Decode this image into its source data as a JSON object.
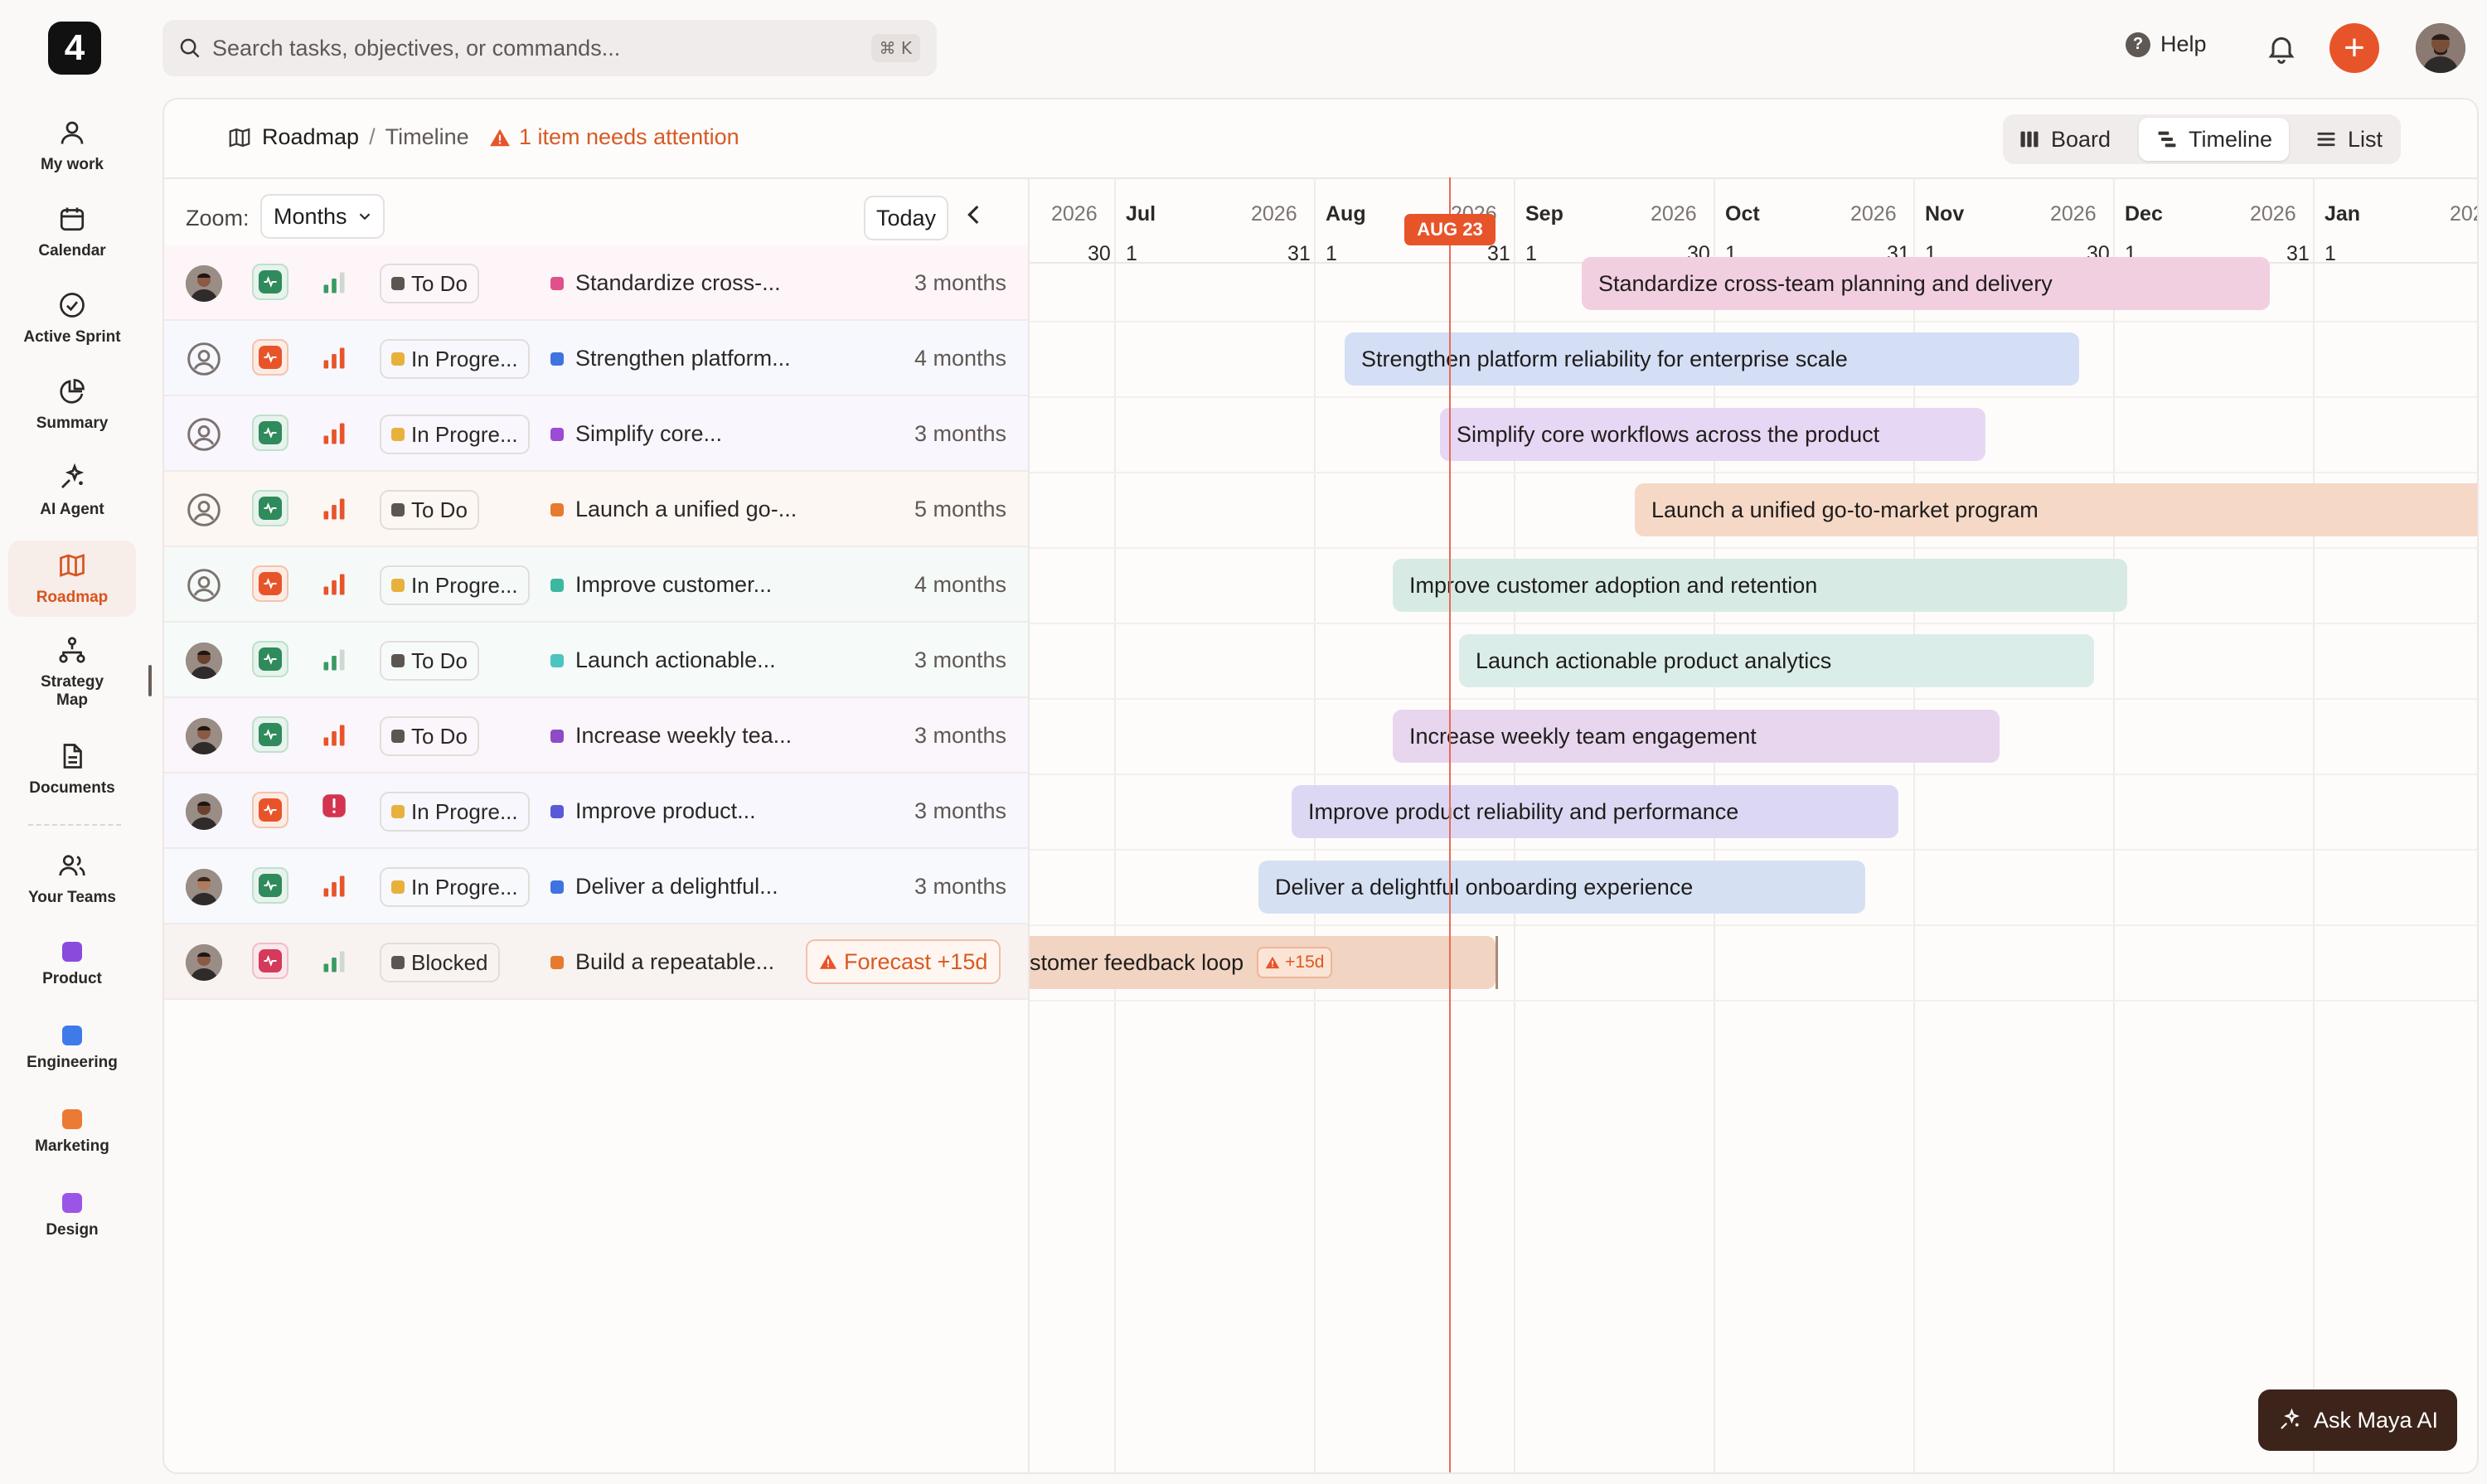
{
  "app": {
    "logo_text": "4"
  },
  "sidebar": {
    "items": [
      {
        "label": "My work"
      },
      {
        "label": "Calendar"
      },
      {
        "label": "Active Sprint"
      },
      {
        "label": "Summary"
      },
      {
        "label": "AI Agent"
      },
      {
        "label": "Roadmap",
        "active": true
      },
      {
        "label": "Strategy Map"
      },
      {
        "label": "Documents"
      }
    ],
    "teams_label": "Your Teams",
    "teams": [
      {
        "label": "Product",
        "color": "#8a4bdc"
      },
      {
        "label": "Engineering",
        "color": "#3f7be8"
      },
      {
        "label": "Marketing",
        "color": "#ec7a34"
      },
      {
        "label": "Design",
        "color": "#9b55e6"
      }
    ]
  },
  "topbar": {
    "search_placeholder": "Search tasks, objectives, or commands...",
    "shortcut": "⌘ K",
    "help_label": "Help",
    "help_icon": "?",
    "plus_symbol": "+"
  },
  "breadcrumb": {
    "root": "Roadmap",
    "separator": "/",
    "current": "Timeline"
  },
  "attention": {
    "text": "1 item needs attention"
  },
  "views": {
    "board": "Board",
    "timeline": "Timeline",
    "list": "List",
    "active": "timeline"
  },
  "toolbar": {
    "zoom_label": "Zoom:",
    "zoom_value": "Months",
    "today": "Today"
  },
  "timeline": {
    "today_label": "AUG 23",
    "header": {
      "years": [
        "2026",
        "2026",
        "2026",
        "2026",
        "2026",
        "2026",
        "2026",
        "202"
      ],
      "months": [
        "Jul",
        "Aug",
        "Sep",
        "Oct",
        "Nov",
        "Dec",
        "Jan"
      ],
      "end_days": [
        "30",
        "31",
        "31",
        "30",
        "31",
        "30",
        "31",
        "3"
      ],
      "start_day": "1"
    }
  },
  "rows": [
    {
      "avatar": "man",
      "health": "green",
      "priority": "medium",
      "status": "To Do",
      "status_color": "#5c5653",
      "dot": "#e0508a",
      "title_short": "Standardize cross-...",
      "duration": "3 months",
      "bar_title": "Standardize cross-team planning and delivery",
      "bar_color": "#f2cfe0",
      "row_bg": "#fdf5f8"
    },
    {
      "avatar": "none",
      "health": "orange",
      "priority": "high",
      "status": "In Progre...",
      "status_color": "#e8b13c",
      "dot": "#3f74e0",
      "title_short": "Strengthen platform...",
      "duration": "4 months",
      "bar_title": "Strengthen platform reliability for enterprise scale",
      "bar_color": "#d4def5",
      "row_bg": "#f7f8fd"
    },
    {
      "avatar": "none",
      "health": "green",
      "priority": "high",
      "status": "In Progre...",
      "status_color": "#e8b13c",
      "dot": "#9b4bd6",
      "title_short": "Simplify core...",
      "duration": "3 months",
      "bar_title": "Simplify core workflows across the product",
      "bar_color": "#e6d8f4",
      "row_bg": "#faf6fd"
    },
    {
      "avatar": "none",
      "health": "green",
      "priority": "high",
      "status": "To Do",
      "status_color": "#5c5653",
      "dot": "#e67a2e",
      "title_short": "Launch a unified go-...",
      "duration": "5 months",
      "bar_title": "Launch a unified go-to-market program",
      "bar_color": "#f5d8c6",
      "row_bg": "#fdf7f3"
    },
    {
      "avatar": "none",
      "health": "orange",
      "priority": "high",
      "status": "In Progre...",
      "status_color": "#e8b13c",
      "dot": "#3cb8a0",
      "title_short": "Improve customer...",
      "duration": "4 months",
      "bar_title": "Improve customer adoption and retention",
      "bar_color": "#d7ebe4",
      "row_bg": "#f5faf8"
    },
    {
      "avatar": "man-dark",
      "health": "green",
      "priority": "medium",
      "status": "To Do",
      "status_color": "#5c5653",
      "dot": "#4cc4c0",
      "title_short": "Launch actionable...",
      "duration": "3 months",
      "bar_title": "Launch actionable product analytics",
      "bar_color": "#dbede8",
      "row_bg": "#f6fbfa"
    },
    {
      "avatar": "man",
      "health": "green",
      "priority": "high",
      "status": "To Do",
      "status_color": "#5c5653",
      "dot": "#8f4bc6",
      "title_short": "Increase weekly tea...",
      "duration": "3 months",
      "bar_title": "Increase weekly team engagement",
      "bar_color": "#e7d6ee",
      "row_bg": "#faf6fb"
    },
    {
      "avatar": "man-dark",
      "health": "orange",
      "priority": "urgent",
      "status": "In Progre...",
      "status_color": "#e8b13c",
      "dot": "#5a5ad6",
      "title_short": "Improve product...",
      "duration": "3 months",
      "bar_title": "Improve product reliability and performance",
      "bar_color": "#dcd8f3",
      "row_bg": "#f7f7fd"
    },
    {
      "avatar": "woman",
      "health": "green",
      "priority": "high",
      "status": "In Progre...",
      "status_color": "#e8b13c",
      "dot": "#3f74e0",
      "title_short": "Deliver a delightful...",
      "duration": "3 months",
      "bar_title": "Deliver a delightful onboarding experience",
      "bar_color": "#d5e1f3",
      "row_bg": "#f7f9fd"
    },
    {
      "avatar": "man",
      "health": "red",
      "priority": "medium",
      "status": "Blocked",
      "status_color": "#5c5653",
      "dot": "#e67a2e",
      "title_short": "Build a repeatable...",
      "duration": "",
      "forecast": "Forecast +15d",
      "bar_title": "stomer feedback loop",
      "bar_warn": "+15d",
      "bar_color": "#f1d4c2",
      "row_bg": "#f8f3f1"
    }
  ],
  "ask_ai": {
    "label": "Ask Maya AI"
  }
}
